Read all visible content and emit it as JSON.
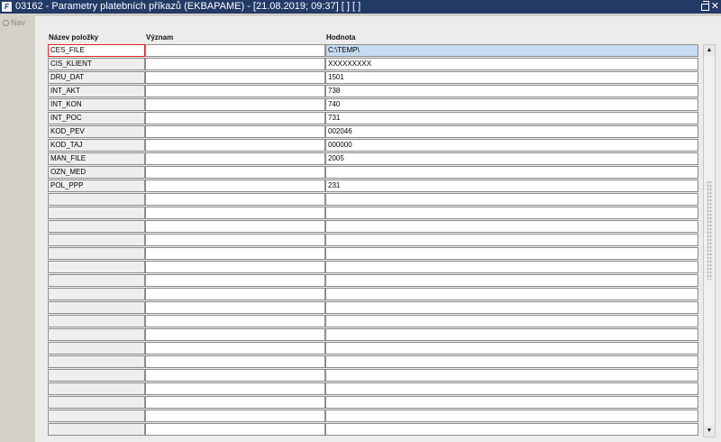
{
  "window": {
    "title": "03162 - Parametry platebních příkazů (EKBAPAME) - [21.08.2019; 09:37]  [ ]  [ ]",
    "app_icon_label": "F",
    "close_glyph": "✕"
  },
  "nav": {
    "label": "Nav"
  },
  "headers": {
    "name": "Název položky",
    "meaning": "Význam",
    "value": "Hodnota"
  },
  "rows": [
    {
      "name": "CES_FILE",
      "meaning": "",
      "value": "C:\\TEMP\\"
    },
    {
      "name": "CIS_KLIENT",
      "meaning": "",
      "value": "XXXXXXXXX"
    },
    {
      "name": "DRU_DAT",
      "meaning": "",
      "value": "1501"
    },
    {
      "name": "INT_AKT",
      "meaning": "",
      "value": "738"
    },
    {
      "name": "INT_KON",
      "meaning": "",
      "value": "740"
    },
    {
      "name": "INT_POC",
      "meaning": "",
      "value": "731"
    },
    {
      "name": "KOD_PEV",
      "meaning": "",
      "value": "002046"
    },
    {
      "name": "KOD_TAJ",
      "meaning": "",
      "value": "000000"
    },
    {
      "name": "MAN_FILE",
      "meaning": "",
      "value": "2005"
    },
    {
      "name": "OZN_MED",
      "meaning": "",
      "value": ""
    },
    {
      "name": "POL_PPP",
      "meaning": "",
      "value": "231"
    },
    {
      "name": "",
      "meaning": "",
      "value": ""
    },
    {
      "name": "",
      "meaning": "",
      "value": ""
    },
    {
      "name": "",
      "meaning": "",
      "value": ""
    },
    {
      "name": "",
      "meaning": "",
      "value": ""
    },
    {
      "name": "",
      "meaning": "",
      "value": ""
    },
    {
      "name": "",
      "meaning": "",
      "value": ""
    },
    {
      "name": "",
      "meaning": "",
      "value": ""
    },
    {
      "name": "",
      "meaning": "",
      "value": ""
    },
    {
      "name": "",
      "meaning": "",
      "value": ""
    },
    {
      "name": "",
      "meaning": "",
      "value": ""
    },
    {
      "name": "",
      "meaning": "",
      "value": ""
    },
    {
      "name": "",
      "meaning": "",
      "value": ""
    },
    {
      "name": "",
      "meaning": "",
      "value": ""
    },
    {
      "name": "",
      "meaning": "",
      "value": ""
    },
    {
      "name": "",
      "meaning": "",
      "value": ""
    },
    {
      "name": "",
      "meaning": "",
      "value": ""
    },
    {
      "name": "",
      "meaning": "",
      "value": ""
    },
    {
      "name": "",
      "meaning": "",
      "value": ""
    }
  ],
  "scroll": {
    "up_glyph": "▲",
    "down_glyph": "▼"
  }
}
